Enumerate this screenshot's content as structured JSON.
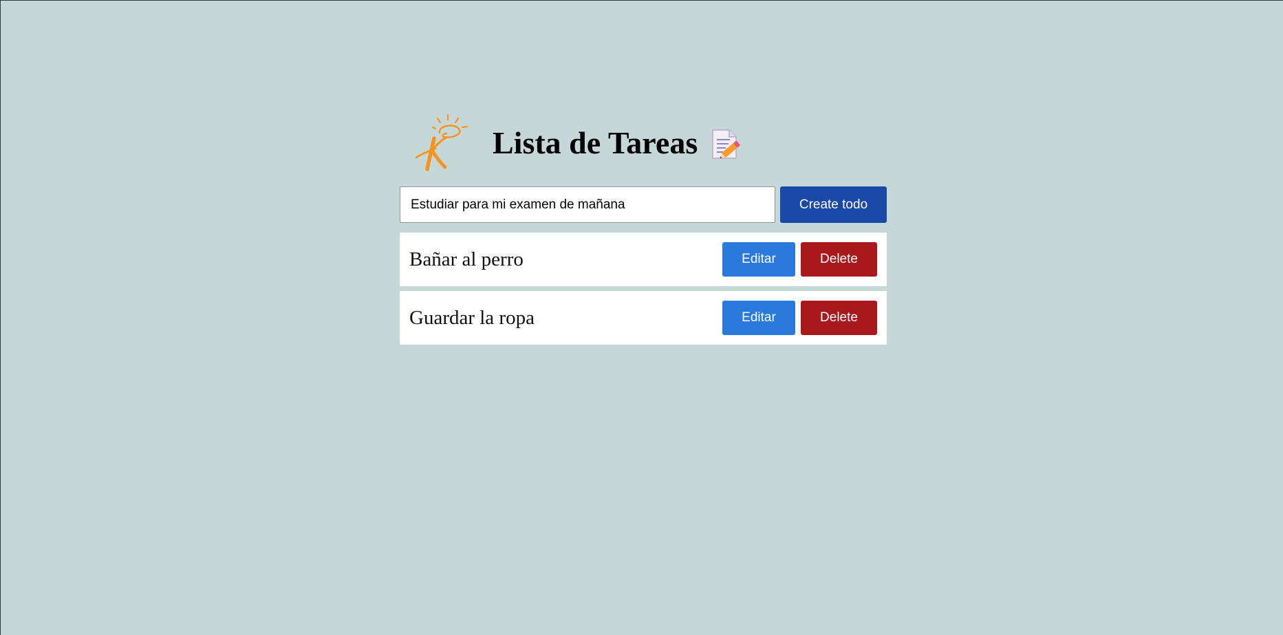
{
  "header": {
    "title": "Lista de Tareas",
    "logo_icon": "k-lightbulb-logo-icon",
    "title_icon": "memo-pencil-icon"
  },
  "form": {
    "input_value": "Estudiar para mi examen de mañana",
    "create_label": "Create todo"
  },
  "todos": [
    {
      "text": "Bañar al perro",
      "edit_label": "Editar",
      "delete_label": "Delete"
    },
    {
      "text": "Guardar la ropa",
      "edit_label": "Editar",
      "delete_label": "Delete"
    }
  ],
  "colors": {
    "background": "#c6d7d8",
    "create_button": "#1849a9",
    "edit_button": "#2a7ade",
    "delete_button": "#a8181c",
    "logo_orange": "#f7931e"
  }
}
